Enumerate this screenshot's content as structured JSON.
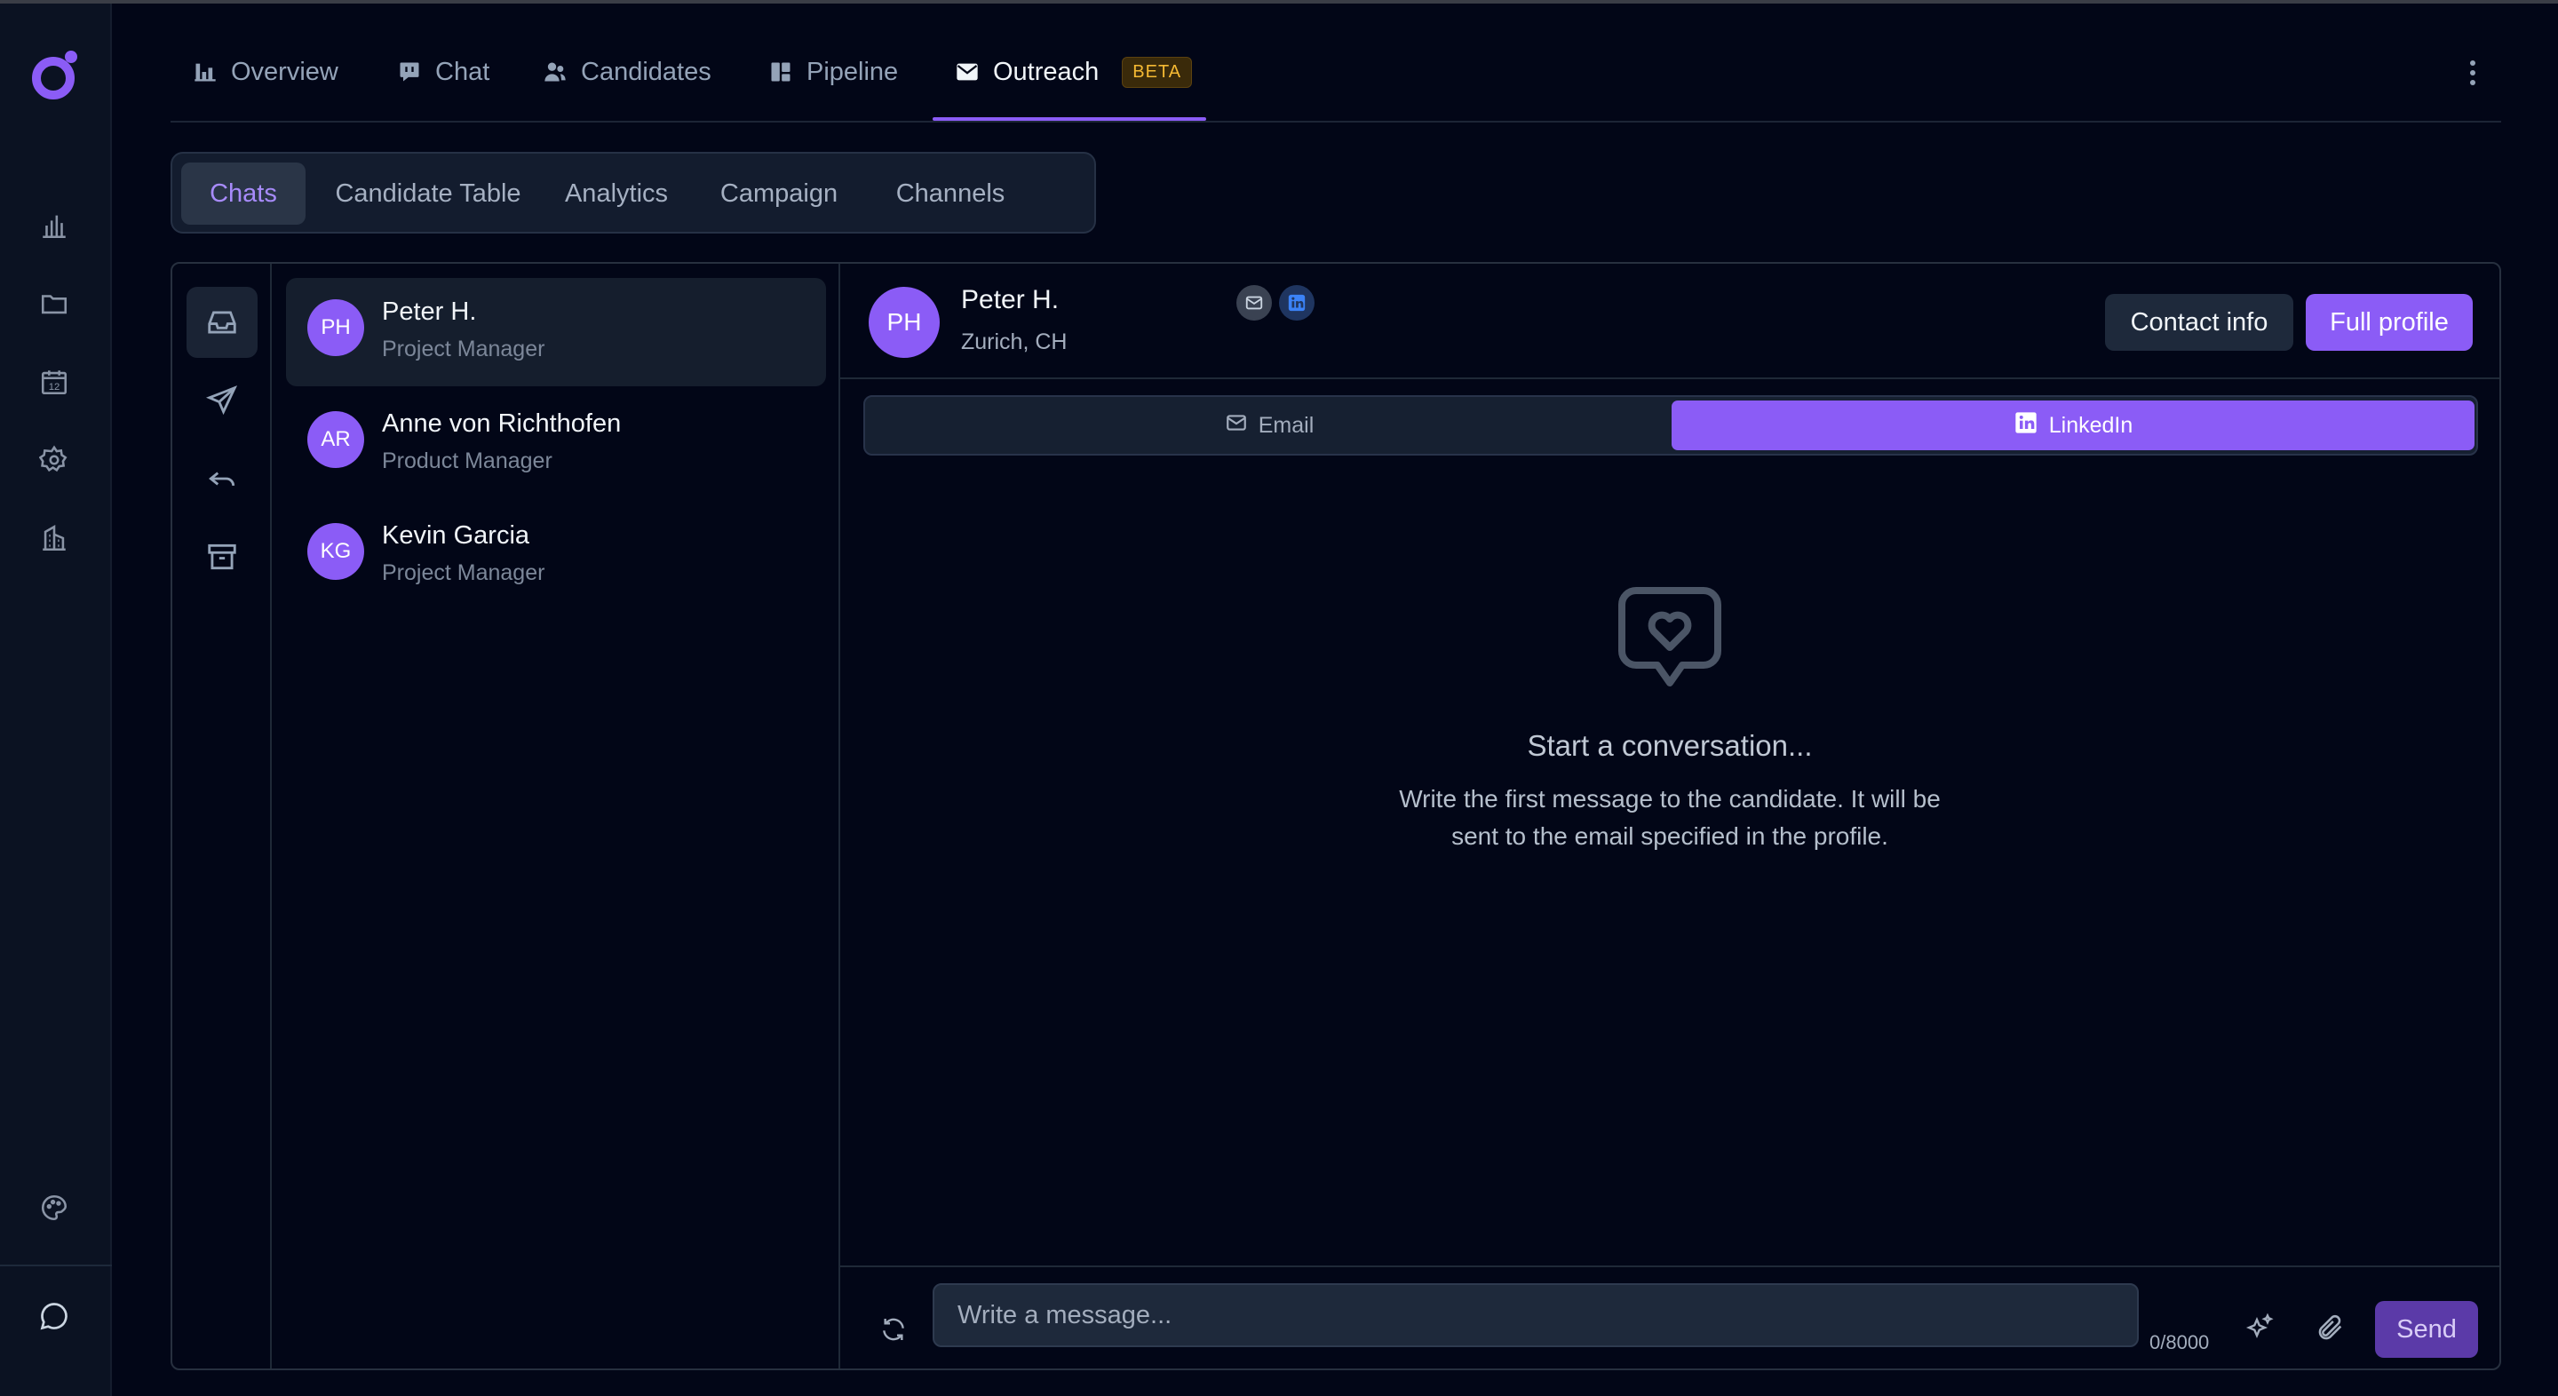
{
  "colors": {
    "accent": "#8b5cf6",
    "background": "#020617",
    "beta_badge": "#f5b933"
  },
  "rail": {
    "logo_icon": "app-logo-icon",
    "items": [
      {
        "icon": "bar-chart-icon"
      },
      {
        "icon": "folder-icon"
      },
      {
        "icon": "calendar-icon",
        "day": "12"
      },
      {
        "icon": "gear-icon"
      },
      {
        "icon": "building-icon"
      }
    ],
    "bottom": [
      {
        "icon": "palette-icon"
      },
      {
        "icon": "chat-bubble-icon"
      }
    ]
  },
  "topnav": {
    "tabs": [
      {
        "label": "Overview",
        "icon": "bar-chart-icon"
      },
      {
        "label": "Chat",
        "icon": "message-icon"
      },
      {
        "label": "Candidates",
        "icon": "users-icon"
      },
      {
        "label": "Pipeline",
        "icon": "kanban-icon"
      },
      {
        "label": "Outreach",
        "icon": "envelope-icon",
        "active": true,
        "badge": "BETA"
      }
    ],
    "menu_icon": "kebab-icon"
  },
  "subtabs": [
    {
      "label": "Chats",
      "active": true
    },
    {
      "label": "Candidate Table"
    },
    {
      "label": "Analytics"
    },
    {
      "label": "Campaign"
    },
    {
      "label": "Channels"
    }
  ],
  "folders": [
    {
      "icon": "inbox-icon",
      "active": true
    },
    {
      "icon": "send-icon"
    },
    {
      "icon": "reply-icon"
    },
    {
      "icon": "archive-icon"
    }
  ],
  "candidates": [
    {
      "initials": "PH",
      "name": "Peter H.",
      "role": "Project Manager",
      "active": true
    },
    {
      "initials": "AR",
      "name": "Anne von Richthofen",
      "role": "Product Manager"
    },
    {
      "initials": "KG",
      "name": "Kevin Garcia",
      "role": "Project Manager"
    }
  ],
  "chat": {
    "header": {
      "initials": "PH",
      "name": "Peter H.",
      "location": "Zurich, CH",
      "contact_button": "Contact info",
      "profile_button": "Full profile"
    },
    "channels": [
      {
        "label": "Email",
        "icon": "envelope-icon"
      },
      {
        "label": "LinkedIn",
        "icon": "linkedin-icon",
        "active": true
      }
    ],
    "empty": {
      "icon": "heart-bubble-icon",
      "title": "Start a conversation...",
      "text": "Write the first message to the candidate. It will be sent to the email specified in the profile."
    },
    "composer": {
      "placeholder": "Write a message...",
      "counter": "0/8000",
      "send_label": "Send"
    }
  }
}
